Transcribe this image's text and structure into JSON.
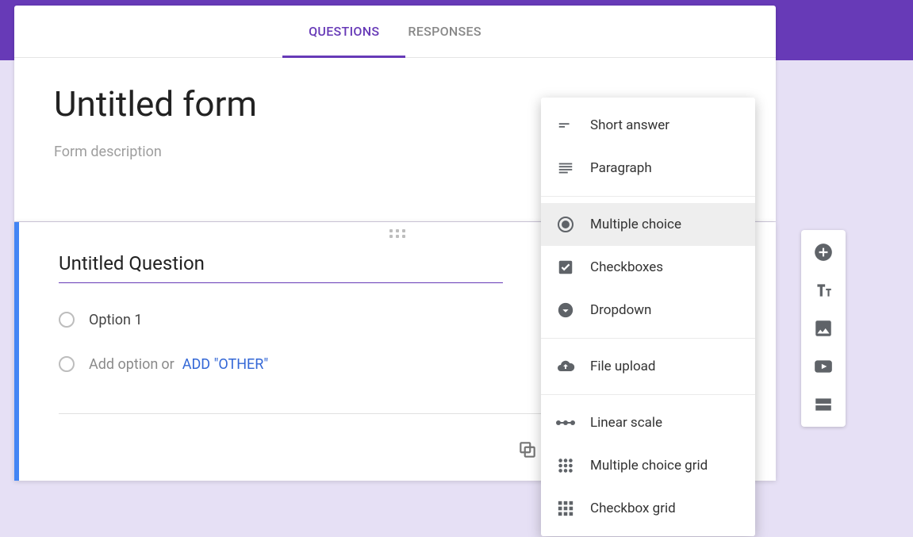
{
  "tabs": {
    "questions": "QUESTIONS",
    "responses": "RESPONSES"
  },
  "form": {
    "title": "Untitled form",
    "description_placeholder": "Form description"
  },
  "question": {
    "title": "Untitled Question",
    "option1": "Option 1",
    "add_option": "Add option",
    "or": "or",
    "add_other": "ADD \"OTHER\""
  },
  "question_types": {
    "short_answer": "Short answer",
    "paragraph": "Paragraph",
    "multiple_choice": "Multiple choice",
    "checkboxes": "Checkboxes",
    "dropdown": "Dropdown",
    "file_upload": "File upload",
    "linear_scale": "Linear scale",
    "multiple_choice_grid": "Multiple choice grid",
    "checkbox_grid": "Checkbox grid"
  },
  "side_toolbar": {
    "add_question": "Add question",
    "add_title": "Add title and description",
    "add_image": "Add image",
    "add_video": "Add video",
    "add_section": "Add section"
  },
  "colors": {
    "accent": "#673ab7",
    "focus": "#4285f4"
  }
}
